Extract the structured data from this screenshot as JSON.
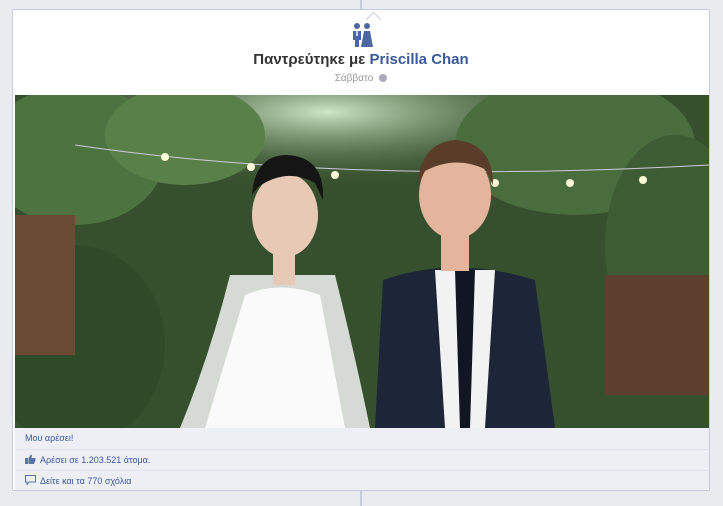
{
  "event": {
    "icon": "wedding-couple-icon",
    "title_prefix": "Παντρεύτηκε με",
    "partner_name": "Priscilla Chan",
    "date": "Σάββατο",
    "privacy_icon": "globe-icon"
  },
  "actions": {
    "like_label": "Μου αρέσει!",
    "likes_summary": "Αρέσει σε 1.203.521 άτομα.",
    "comments_link": "Δείτε και τα 770 σχόλια",
    "like_icon": "thumbs-up-icon",
    "comment_icon": "comment-icon"
  },
  "colors": {
    "link": "#3b5998",
    "panel": "#edeff4"
  }
}
